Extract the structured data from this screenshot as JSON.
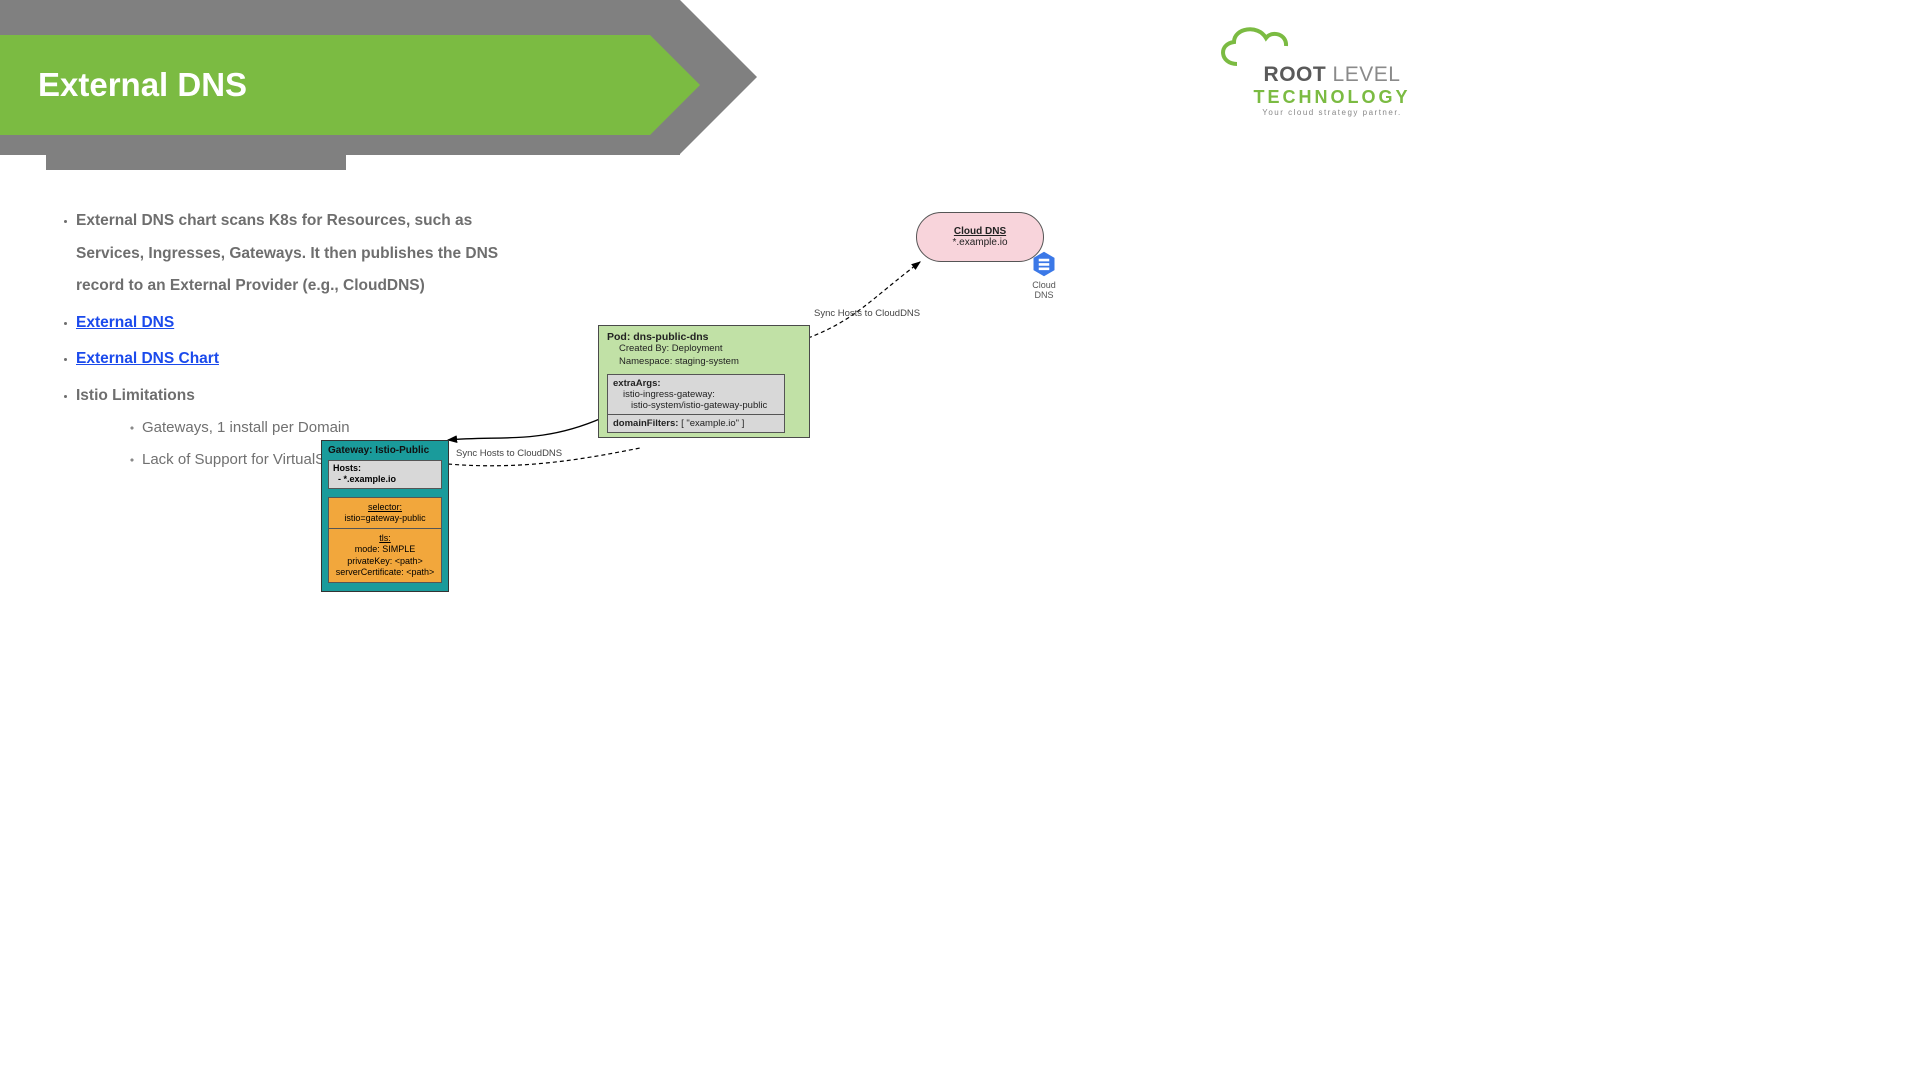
{
  "title": "External DNS",
  "logo": {
    "root": "ROOT",
    "level": " LEVEL",
    "tech": "TECHNOLOGY",
    "tag": "Your cloud strategy partner."
  },
  "bullets": {
    "desc": "External DNS chart scans K8s for Resources, such as Services, Ingresses, Gateways.  It then publishes the DNS record to an External Provider (e.g., CloudDNS)",
    "link1": "External DNS",
    "link2": "External DNS Chart",
    "istio_title": "Istio Limitations",
    "istio_sub1": "Gateways, 1 install per Domain",
    "istio_sub2": "Lack of Support for VirtualServices"
  },
  "diagram": {
    "cloud_dns_title": "Cloud DNS",
    "cloud_dns_domain": "*.example.io",
    "cloud_dns_icon_label": "Cloud DNS",
    "sync_label": "Sync Hosts to CloudDNS",
    "pod": {
      "title": "Pod: dns-public-dns",
      "created": "Created By: Deployment",
      "ns": "Namespace: staging-system",
      "extra_args_key": "extraArgs:",
      "extra_args_l1": "istio-ingress-gateway:",
      "extra_args_l2": "istio-system/istio-gateway-public",
      "domain_filters_key": "domainFilters:",
      "domain_filters_val": " [ \"example.io\" ]"
    },
    "gateway": {
      "title": "Gateway: Istio-Public",
      "hosts_key": "Hosts:",
      "hosts_val": "  - *.example.io",
      "selector_key": "selector:",
      "selector_val": "istio=gateway-public",
      "tls_key": "tls:",
      "tls_mode": "mode: SIMPLE",
      "tls_pkey": "privateKey: <path>",
      "tls_cert": "serverCertificate: <path>"
    }
  }
}
